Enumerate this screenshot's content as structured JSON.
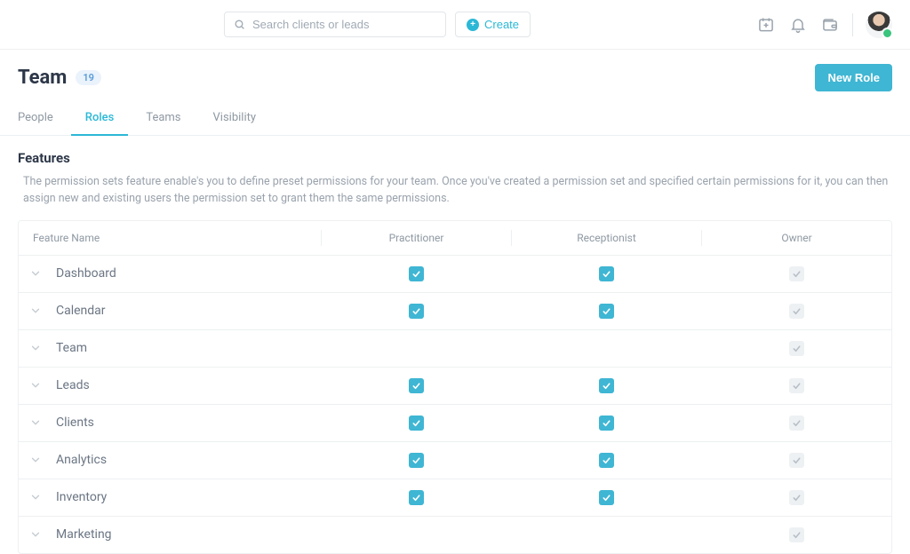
{
  "topbar": {
    "search_placeholder": "Search clients or leads",
    "create_label": "Create"
  },
  "header": {
    "title": "Team",
    "count": "19",
    "new_role_label": "New Role"
  },
  "tabs": [
    {
      "label": "People",
      "active": false
    },
    {
      "label": "Roles",
      "active": true
    },
    {
      "label": "Teams",
      "active": false
    },
    {
      "label": "Visibility",
      "active": false
    }
  ],
  "section": {
    "title": "Features",
    "description": "The permission sets feature enable's you to define preset permissions for your team. Once you've created a permission set and specified certain permissions for it, you can then assign new and existing users the permission set to grant them the same permissions."
  },
  "table": {
    "columns": {
      "name": "Feature Name",
      "role1": "Practitioner",
      "role2": "Receptionist",
      "role3": "Owner"
    },
    "rows": [
      {
        "name": "Dashboard",
        "practitioner": "on",
        "receptionist": "on",
        "owner": "locked"
      },
      {
        "name": "Calendar",
        "practitioner": "on",
        "receptionist": "on",
        "owner": "locked"
      },
      {
        "name": "Team",
        "practitioner": "off",
        "receptionist": "off",
        "owner": "locked"
      },
      {
        "name": "Leads",
        "practitioner": "on",
        "receptionist": "on",
        "owner": "locked"
      },
      {
        "name": "Clients",
        "practitioner": "on",
        "receptionist": "on",
        "owner": "locked"
      },
      {
        "name": "Analytics",
        "practitioner": "on",
        "receptionist": "on",
        "owner": "locked"
      },
      {
        "name": "Inventory",
        "practitioner": "on",
        "receptionist": "on",
        "owner": "locked"
      },
      {
        "name": "Marketing",
        "practitioner": "off",
        "receptionist": "off",
        "owner": "locked"
      }
    ]
  }
}
